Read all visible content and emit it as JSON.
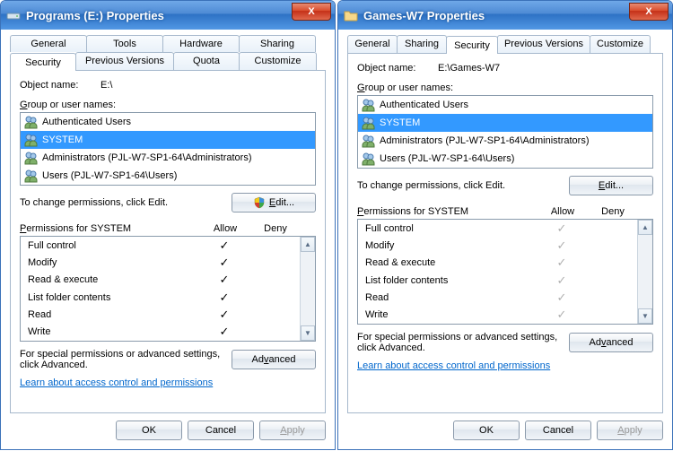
{
  "windows": [
    {
      "id": "left",
      "title": "Programs (E:) Properties",
      "icon": "drive-icon",
      "object_name_label": "Object name:",
      "object_name_value": "E:\\",
      "tabs_row1": [
        "General",
        "Tools",
        "Hardware",
        "Sharing"
      ],
      "tabs_row2": [
        "Security",
        "Previous Versions",
        "Quota",
        "Customize"
      ],
      "active_tab": "Security",
      "group_label": "Group or user names:",
      "groups": [
        {
          "name": "Authenticated Users",
          "selected": false
        },
        {
          "name": "SYSTEM",
          "selected": true
        },
        {
          "name": "Administrators (PJL-W7-SP1-64\\Administrators)",
          "selected": false
        },
        {
          "name": "Users (PJL-W7-SP1-64\\Users)",
          "selected": false
        }
      ],
      "edit_hint": "To change permissions, click Edit.",
      "edit_button": "Edit...",
      "edit_has_shield": true,
      "perm_label": "Permissions for SYSTEM",
      "allow_label": "Allow",
      "deny_label": "Deny",
      "permissions": [
        {
          "name": "Full control",
          "allow": true,
          "deny": false
        },
        {
          "name": "Modify",
          "allow": true,
          "deny": false
        },
        {
          "name": "Read & execute",
          "allow": true,
          "deny": false
        },
        {
          "name": "List folder contents",
          "allow": true,
          "deny": false
        },
        {
          "name": "Read",
          "allow": true,
          "deny": false
        },
        {
          "name": "Write",
          "allow": true,
          "deny": false
        }
      ],
      "perm_check_style": "black",
      "adv_hint": "For special permissions or advanced settings, click Advanced.",
      "adv_button": "Advanced",
      "link": "Learn about access control and permissions",
      "ok": "OK",
      "cancel": "Cancel",
      "apply": "Apply"
    },
    {
      "id": "right",
      "title": "Games-W7 Properties",
      "icon": "folder-icon",
      "object_name_label": "Object name:",
      "object_name_value": "E:\\Games-W7",
      "tabs_single": [
        "General",
        "Sharing",
        "Security",
        "Previous Versions",
        "Customize"
      ],
      "active_tab": "Security",
      "group_label": "Group or user names:",
      "groups": [
        {
          "name": "Authenticated Users",
          "selected": false
        },
        {
          "name": "SYSTEM",
          "selected": true
        },
        {
          "name": "Administrators (PJL-W7-SP1-64\\Administrators)",
          "selected": false
        },
        {
          "name": "Users (PJL-W7-SP1-64\\Users)",
          "selected": false
        }
      ],
      "edit_hint": "To change permissions, click Edit.",
      "edit_button": "Edit...",
      "edit_has_shield": false,
      "perm_label": "Permissions for SYSTEM",
      "allow_label": "Allow",
      "deny_label": "Deny",
      "permissions": [
        {
          "name": "Full control",
          "allow": true,
          "deny": false
        },
        {
          "name": "Modify",
          "allow": true,
          "deny": false
        },
        {
          "name": "Read & execute",
          "allow": true,
          "deny": false
        },
        {
          "name": "List folder contents",
          "allow": true,
          "deny": false
        },
        {
          "name": "Read",
          "allow": true,
          "deny": false
        },
        {
          "name": "Write",
          "allow": true,
          "deny": false
        }
      ],
      "perm_check_style": "grey",
      "adv_hint": "For special permissions or advanced settings, click Advanced.",
      "adv_button": "Advanced",
      "link": "Learn about access control and permissions",
      "ok": "OK",
      "cancel": "Cancel",
      "apply": "Apply"
    }
  ]
}
